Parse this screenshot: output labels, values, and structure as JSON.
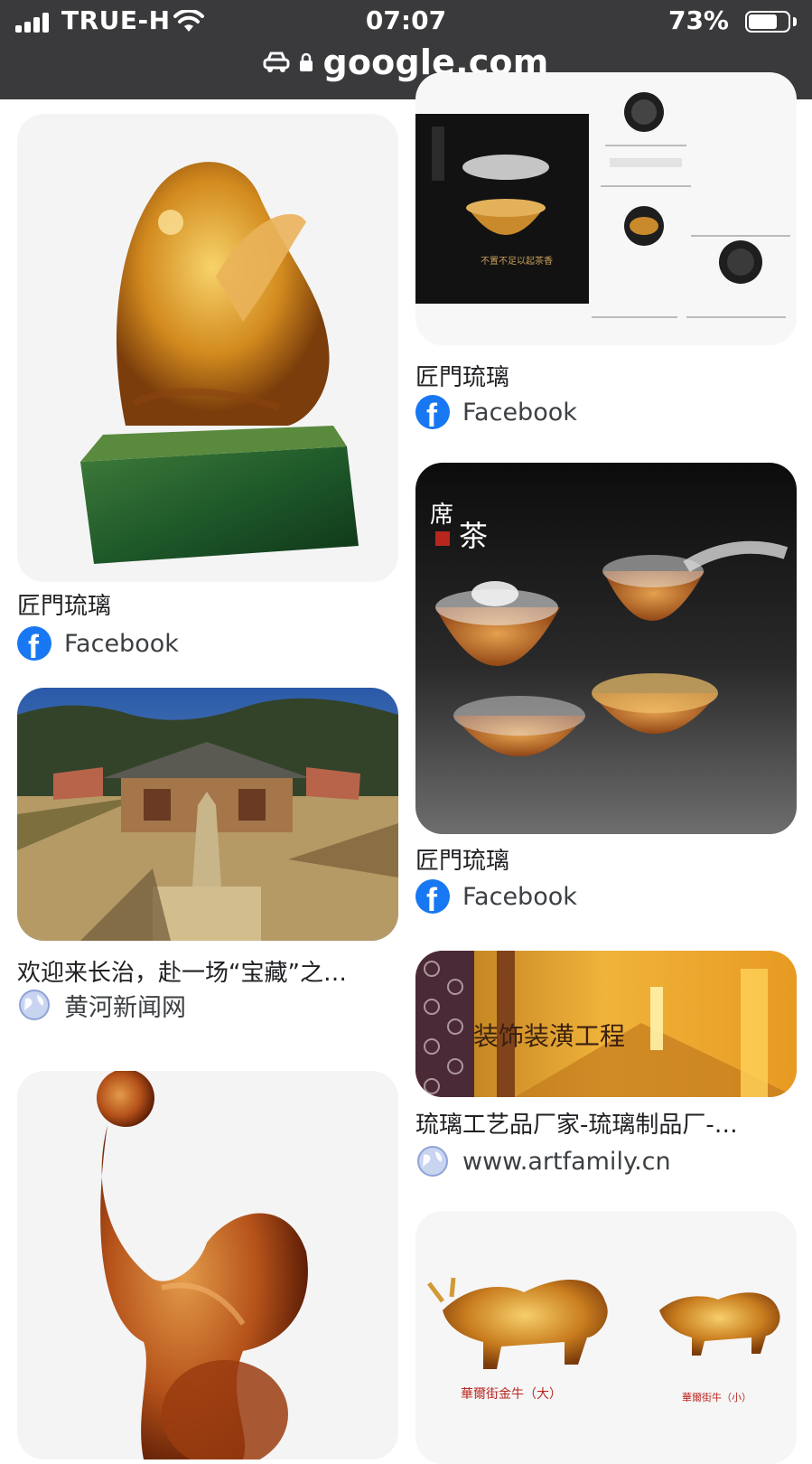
{
  "status_bar": {
    "carrier": "TRUE-H",
    "time": "07:07",
    "battery_percent": "73%",
    "battery_level": 0.73
  },
  "url_bar": {
    "domain": "google.com"
  },
  "results": {
    "left": [
      {
        "caption": "",
        "source": "",
        "kind": "image-only-top"
      },
      {
        "caption": "匠門琉璃",
        "source": "Facebook",
        "icon": "facebook-icon"
      },
      {
        "caption": "欢迎来长治，赴一场“宝藏”之…",
        "source": "黄河新闻网",
        "icon": "globe-icon"
      },
      {
        "caption": "",
        "source": "",
        "kind": "image-only-bottom"
      }
    ],
    "right": [
      {
        "caption": "匠門琉璃",
        "source": "Facebook",
        "icon": "facebook-icon"
      },
      {
        "caption": "匠門琉璃",
        "source": "Facebook",
        "icon": "facebook-icon"
      },
      {
        "caption": "琉璃工艺品厂家-琉璃制品厂-…",
        "source": "www.artfamily.cn",
        "icon": "globe-icon"
      },
      {
        "caption": "",
        "source": "",
        "kind": "image-only-bottom"
      }
    ]
  },
  "image_text": {
    "tea_set_banner": "席",
    "tea_set_banner_char": "茶",
    "decoration_banner": "装饰装潢工程",
    "bull_label_large": "華爾街金牛（大）",
    "bull_label_small": "華爾街牛（小）",
    "cup_promo_line": "不置不足以起茶香"
  },
  "colors": {
    "topbar": "#3a3a3c",
    "facebook_blue": "#1877f2",
    "caption_text": "#202124",
    "source_text": "#3c4043"
  }
}
